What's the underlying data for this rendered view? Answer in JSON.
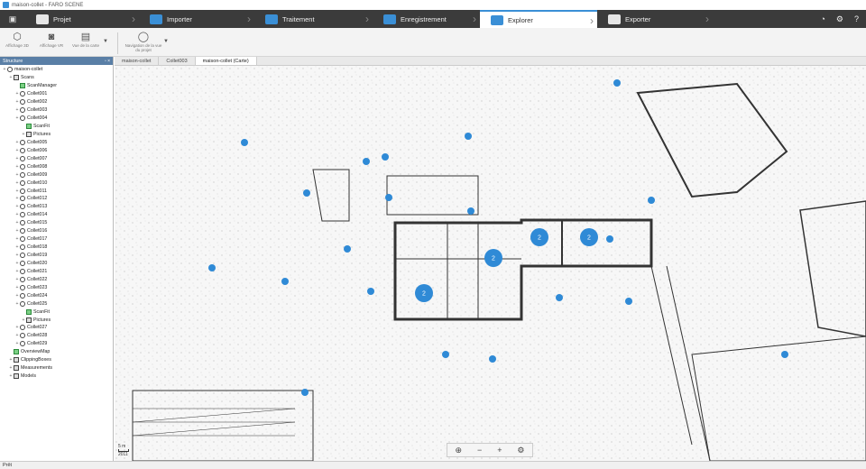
{
  "titlebar": {
    "text": "maison-collet - FARO SCENE"
  },
  "workflow": {
    "steps": [
      {
        "label": "Projet",
        "icon": "folder-icon"
      },
      {
        "label": "Importer",
        "icon": "import-icon"
      },
      {
        "label": "Traitement",
        "icon": "process-icon"
      },
      {
        "label": "Enregistrement",
        "icon": "register-icon"
      },
      {
        "label": "Explorer",
        "icon": "explore-icon"
      },
      {
        "label": "Exporter",
        "icon": "export-icon"
      }
    ],
    "active_index": 4
  },
  "toolbar": {
    "tools": [
      {
        "label": "Affichage 3D",
        "icon": "cube-icon"
      },
      {
        "label": "Affichage VR",
        "icon": "vr-headset-icon"
      },
      {
        "label": "Vue de la carte",
        "icon": "map-icon"
      },
      {
        "label": "Navigation de la vue du projet",
        "icon": "navigation-icon"
      }
    ]
  },
  "structure": {
    "title": "Structure",
    "nodes": [
      {
        "label": "maison-collet",
        "depth": 0,
        "icon": "project"
      },
      {
        "label": "Scans",
        "depth": 1,
        "icon": "folder"
      },
      {
        "label": "ScanManager",
        "depth": 2,
        "icon": "green"
      },
      {
        "label": "Collet001",
        "depth": 2,
        "icon": "scan"
      },
      {
        "label": "Collet002",
        "depth": 2,
        "icon": "scan"
      },
      {
        "label": "Collet003",
        "depth": 2,
        "icon": "scan"
      },
      {
        "label": "Collet004",
        "depth": 2,
        "icon": "scan"
      },
      {
        "label": "ScanFit",
        "depth": 3,
        "icon": "green"
      },
      {
        "label": "Pictures",
        "depth": 3,
        "icon": "folder"
      },
      {
        "label": "Collet005",
        "depth": 2,
        "icon": "scan"
      },
      {
        "label": "Collet006",
        "depth": 2,
        "icon": "scan"
      },
      {
        "label": "Collet007",
        "depth": 2,
        "icon": "scan"
      },
      {
        "label": "Collet008",
        "depth": 2,
        "icon": "scan"
      },
      {
        "label": "Collet009",
        "depth": 2,
        "icon": "scan"
      },
      {
        "label": "Collet010",
        "depth": 2,
        "icon": "scan"
      },
      {
        "label": "Collet011",
        "depth": 2,
        "icon": "scan"
      },
      {
        "label": "Collet012",
        "depth": 2,
        "icon": "scan"
      },
      {
        "label": "Collet013",
        "depth": 2,
        "icon": "scan"
      },
      {
        "label": "Collet014",
        "depth": 2,
        "icon": "scan"
      },
      {
        "label": "Collet015",
        "depth": 2,
        "icon": "scan"
      },
      {
        "label": "Collet016",
        "depth": 2,
        "icon": "scan"
      },
      {
        "label": "Collet017",
        "depth": 2,
        "icon": "scan"
      },
      {
        "label": "Collet018",
        "depth": 2,
        "icon": "scan"
      },
      {
        "label": "Collet019",
        "depth": 2,
        "icon": "scan"
      },
      {
        "label": "Collet020",
        "depth": 2,
        "icon": "scan"
      },
      {
        "label": "Collet021",
        "depth": 2,
        "icon": "scan"
      },
      {
        "label": "Collet022",
        "depth": 2,
        "icon": "scan"
      },
      {
        "label": "Collet023",
        "depth": 2,
        "icon": "scan"
      },
      {
        "label": "Collet024",
        "depth": 2,
        "icon": "scan"
      },
      {
        "label": "Collet025",
        "depth": 2,
        "icon": "scan"
      },
      {
        "label": "ScanFit",
        "depth": 3,
        "icon": "green"
      },
      {
        "label": "Pictures",
        "depth": 3,
        "icon": "folder"
      },
      {
        "label": "Collet027",
        "depth": 2,
        "icon": "scan"
      },
      {
        "label": "Collet028",
        "depth": 2,
        "icon": "scan"
      },
      {
        "label": "Collet029",
        "depth": 2,
        "icon": "scan"
      },
      {
        "label": "OverviewMap",
        "depth": 1,
        "icon": "green"
      },
      {
        "label": "ClippingBoxes",
        "depth": 1,
        "icon": "folder"
      },
      {
        "label": "Measurements",
        "depth": 1,
        "icon": "folder"
      },
      {
        "label": "Models",
        "depth": 1,
        "icon": "folder"
      }
    ]
  },
  "tabs": [
    {
      "label": "maison-collet"
    },
    {
      "label": "Collet003"
    },
    {
      "label": "maison-collet (Carte)"
    }
  ],
  "active_tab": 2,
  "map": {
    "scale_label": "5 m",
    "scale_sub": "2011",
    "cluster_label": "2",
    "controls": [
      {
        "name": "zoom-fit-button",
        "glyph": "⊕"
      },
      {
        "name": "zoom-out-button",
        "glyph": "−"
      },
      {
        "name": "zoom-in-button",
        "glyph": "+"
      },
      {
        "name": "map-settings-button",
        "glyph": "⚙"
      }
    ]
  },
  "status": {
    "text": "Prêt"
  },
  "colors": {
    "accent": "#3a8fd6",
    "scan_dot": "#2f8ad6",
    "toolbar_dark": "#3b3b3b"
  }
}
